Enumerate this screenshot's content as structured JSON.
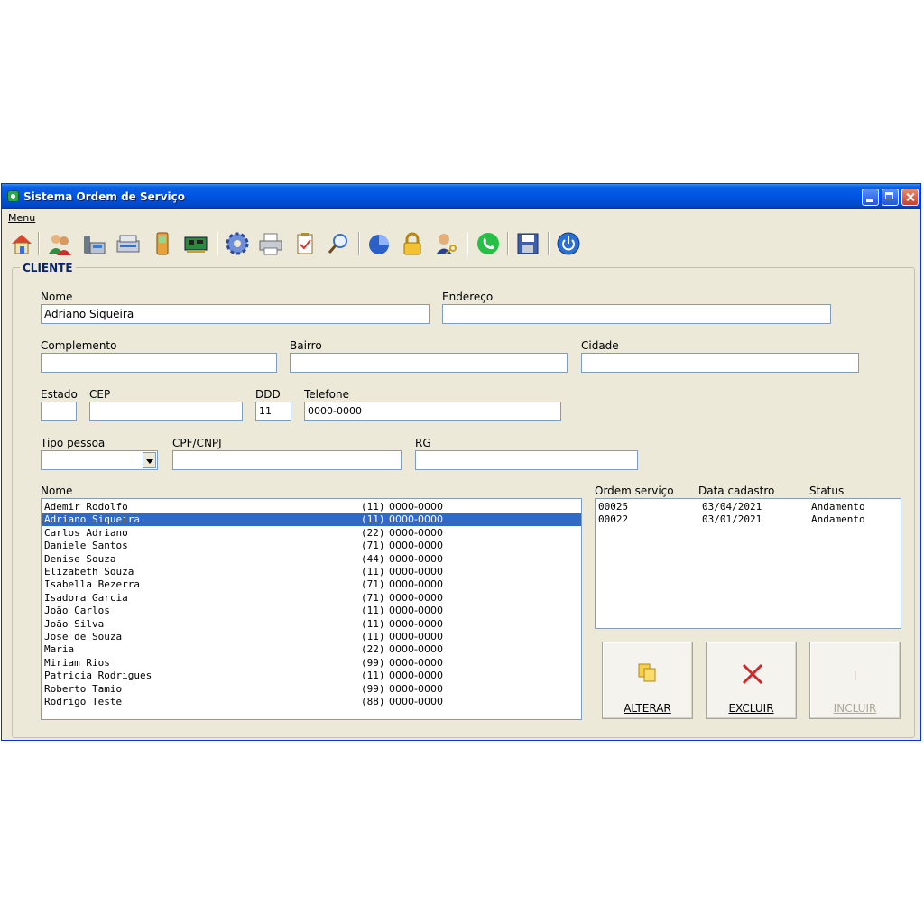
{
  "window": {
    "title": "Sistema Ordem de Serviço"
  },
  "menu": {
    "items": [
      "Menu"
    ]
  },
  "toolbar": {
    "icons": [
      "home-icon",
      "users-icon",
      "phone-fax-icon",
      "scanner-icon",
      "mobile-phone-icon",
      "circuit-board-icon",
      "gear-icon",
      "printer-icon",
      "checklist-icon",
      "search-icon",
      "pie-chart-icon",
      "lock-icon",
      "user-key-icon",
      "whatsapp-icon",
      "save-icon",
      "power-icon"
    ]
  },
  "group": {
    "title": "CLIENTE"
  },
  "form": {
    "nome": {
      "label": "Nome",
      "value": "Adriano Siqueira"
    },
    "endereco": {
      "label": "Endereço",
      "value": ""
    },
    "complemento": {
      "label": "Complemento",
      "value": ""
    },
    "bairro": {
      "label": "Bairro",
      "value": ""
    },
    "cidade": {
      "label": "Cidade",
      "value": ""
    },
    "estado": {
      "label": "Estado",
      "value": ""
    },
    "cep": {
      "label": "CEP",
      "value": ""
    },
    "ddd": {
      "label": "DDD",
      "value": "11"
    },
    "telefone": {
      "label": "Telefone",
      "value": "0000-0000"
    },
    "tipo_pessoa": {
      "label": "Tipo pessoa",
      "value": ""
    },
    "cpf_cnpj": {
      "label": "CPF/CNPJ",
      "value": ""
    },
    "rg": {
      "label": "RG",
      "value": ""
    }
  },
  "clients": {
    "header": "Nome",
    "selected_index": 1,
    "rows": [
      {
        "name": "Ademir Rodolfo",
        "ddd": "(11)",
        "phone": "0000-0000"
      },
      {
        "name": "Adriano Siqueira",
        "ddd": "(11)",
        "phone": "0000-0000"
      },
      {
        "name": "Carlos Adriano",
        "ddd": "(22)",
        "phone": "0000-0000"
      },
      {
        "name": "Daniele Santos",
        "ddd": "(71)",
        "phone": "0000-0000"
      },
      {
        "name": "Denise Souza",
        "ddd": "(44)",
        "phone": "0000-0000"
      },
      {
        "name": "Elizabeth Souza",
        "ddd": "(11)",
        "phone": "0000-0000"
      },
      {
        "name": "Isabella Bezerra",
        "ddd": "(71)",
        "phone": "0000-0000"
      },
      {
        "name": "Isadora Garcia",
        "ddd": "(71)",
        "phone": "0000-0000"
      },
      {
        "name": "João Carlos",
        "ddd": "(11)",
        "phone": "0000-0000"
      },
      {
        "name": "João Silva",
        "ddd": "(11)",
        "phone": "0000-0000"
      },
      {
        "name": "Jose de Souza",
        "ddd": "(11)",
        "phone": "0000-0000"
      },
      {
        "name": "Maria",
        "ddd": "(22)",
        "phone": "0000-0000"
      },
      {
        "name": "Miriam Rios",
        "ddd": "(99)",
        "phone": "0000-0000"
      },
      {
        "name": "Patricia Rodrigues",
        "ddd": "(11)",
        "phone": "0000-0000"
      },
      {
        "name": "Roberto Tamio",
        "ddd": "(99)",
        "phone": "0000-0000"
      },
      {
        "name": "Rodrigo Teste",
        "ddd": "(88)",
        "phone": "0000-0000"
      }
    ]
  },
  "orders": {
    "headers": [
      "Ordem serviço",
      "Data cadastro",
      "Status"
    ],
    "rows": [
      {
        "os": "00025",
        "date": "03/04/2021",
        "status": "Andamento"
      },
      {
        "os": "00022",
        "date": "03/01/2021",
        "status": "Andamento"
      }
    ]
  },
  "buttons": {
    "alterar": {
      "label": "ALTERAR",
      "icon": "copy-icon",
      "enabled": true
    },
    "excluir": {
      "label": "EXCLUIR",
      "icon": "delete-x-icon",
      "enabled": true
    },
    "incluir": {
      "label": "INCLUIR",
      "icon": "add-icon",
      "enabled": false
    }
  },
  "colors": {
    "title_bar": "#0054e3",
    "selection": "#316ac5",
    "window_bg": "#ece9d8",
    "group_title": "#0a246a"
  }
}
